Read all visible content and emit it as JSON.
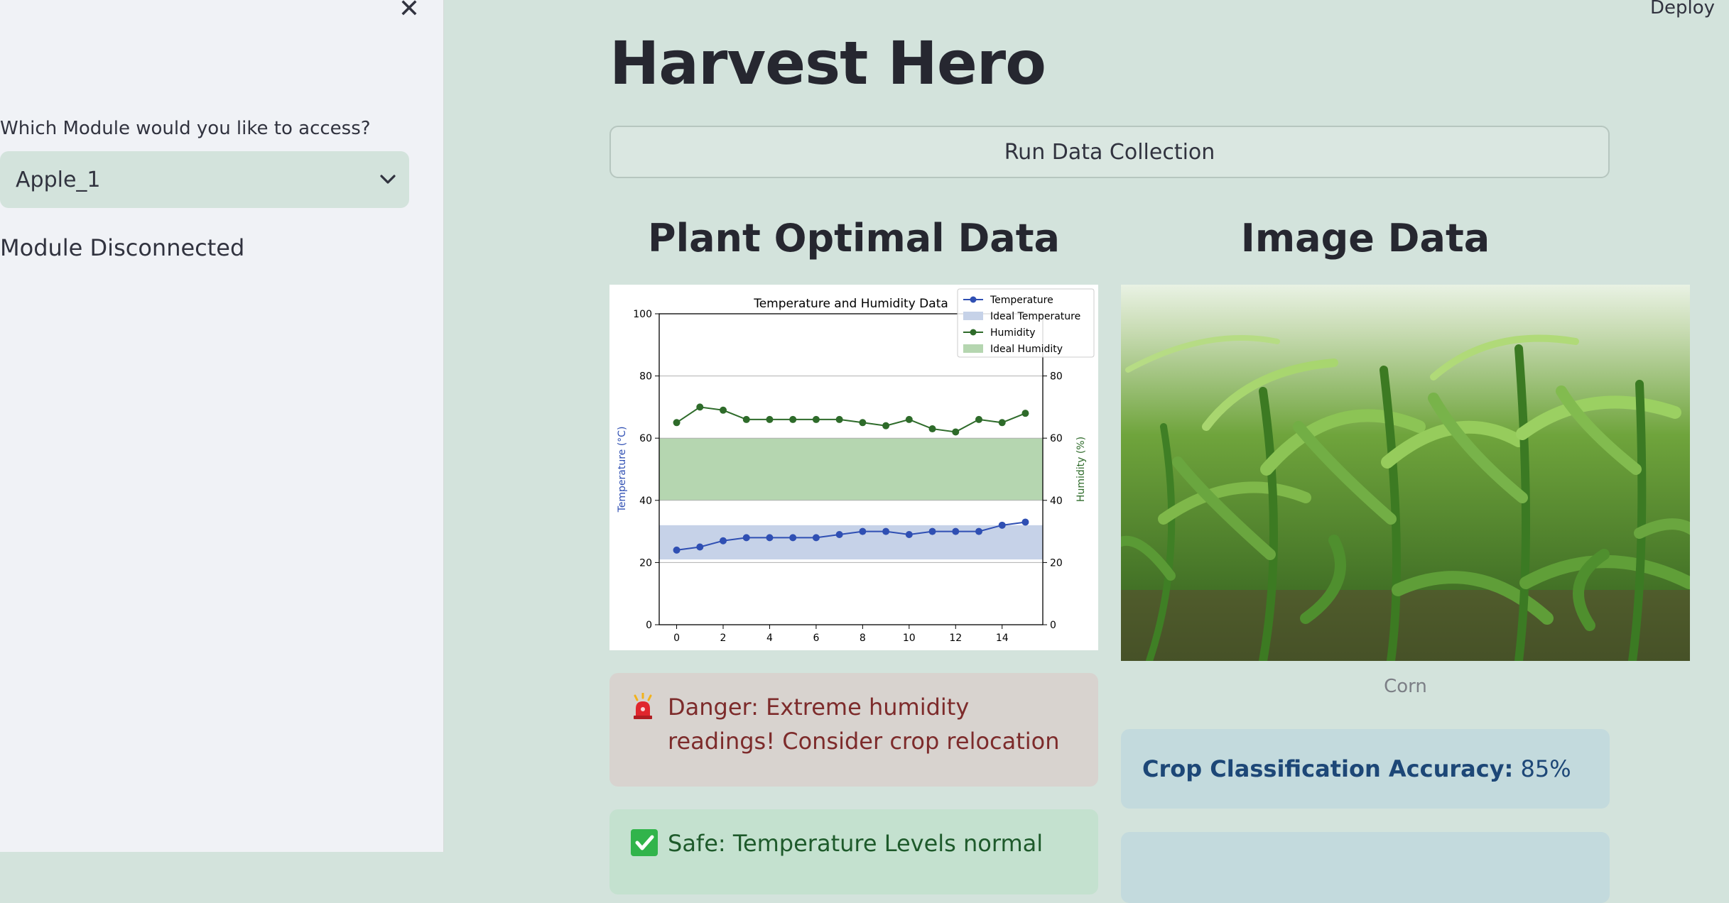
{
  "sidebar": {
    "select_label": "Which Module would you like to access?",
    "selected_module": "Apple_1",
    "status": "Module Disconnected"
  },
  "header": {
    "deploy_label": "Deploy"
  },
  "main": {
    "title": "Harvest Hero",
    "run_button_label": "Run Data Collection",
    "left_heading": "Plant Optimal Data",
    "right_heading": "Image Data",
    "image_caption": "Corn",
    "danger_text": "Danger: Extreme humidity readings! Consider crop relocation",
    "success_text": "Safe: Temperature Levels normal",
    "accuracy_label": "Crop Classification Accuracy:",
    "accuracy_value": "85%"
  },
  "colors": {
    "temperature": "#2f4fb3",
    "humidity": "#2e6b2a",
    "ideal_temperature": "#c6d2e8",
    "ideal_humidity": "#b5d6b0"
  },
  "chart_data": {
    "type": "line",
    "title": "Temperature and Humidity Data",
    "xlabel": "",
    "ylabel_left": "Temperature (°C)",
    "ylabel_right": "Humidity (%)",
    "x": [
      0,
      1,
      2,
      3,
      4,
      5,
      6,
      7,
      8,
      9,
      10,
      11,
      12,
      13,
      14,
      15
    ],
    "x_ticks": [
      0,
      2,
      4,
      6,
      8,
      10,
      12,
      14
    ],
    "y_ticks": [
      0,
      20,
      40,
      60,
      80,
      100
    ],
    "y_right_ticks": [
      0,
      20,
      40,
      60,
      80
    ],
    "ylim": [
      0,
      100
    ],
    "grid": "horizontal",
    "legend_position": "top-right",
    "series": [
      {
        "name": "Temperature",
        "axis": "left",
        "color": "#2f4fb3",
        "values": [
          24,
          25,
          27,
          28,
          28,
          28,
          28,
          29,
          30,
          30,
          29,
          30,
          30,
          30,
          32,
          33
        ]
      },
      {
        "name": "Humidity",
        "axis": "right",
        "color": "#2e6b2a",
        "values": [
          65,
          70,
          69,
          66,
          66,
          66,
          66,
          66,
          65,
          64,
          66,
          63,
          62,
          66,
          65,
          68
        ]
      }
    ],
    "bands": [
      {
        "name": "Ideal Temperature",
        "range": [
          21,
          32
        ],
        "color": "#c6d2e8"
      },
      {
        "name": "Ideal Humidity",
        "range": [
          40,
          60
        ],
        "color": "#b5d6b0"
      }
    ]
  }
}
